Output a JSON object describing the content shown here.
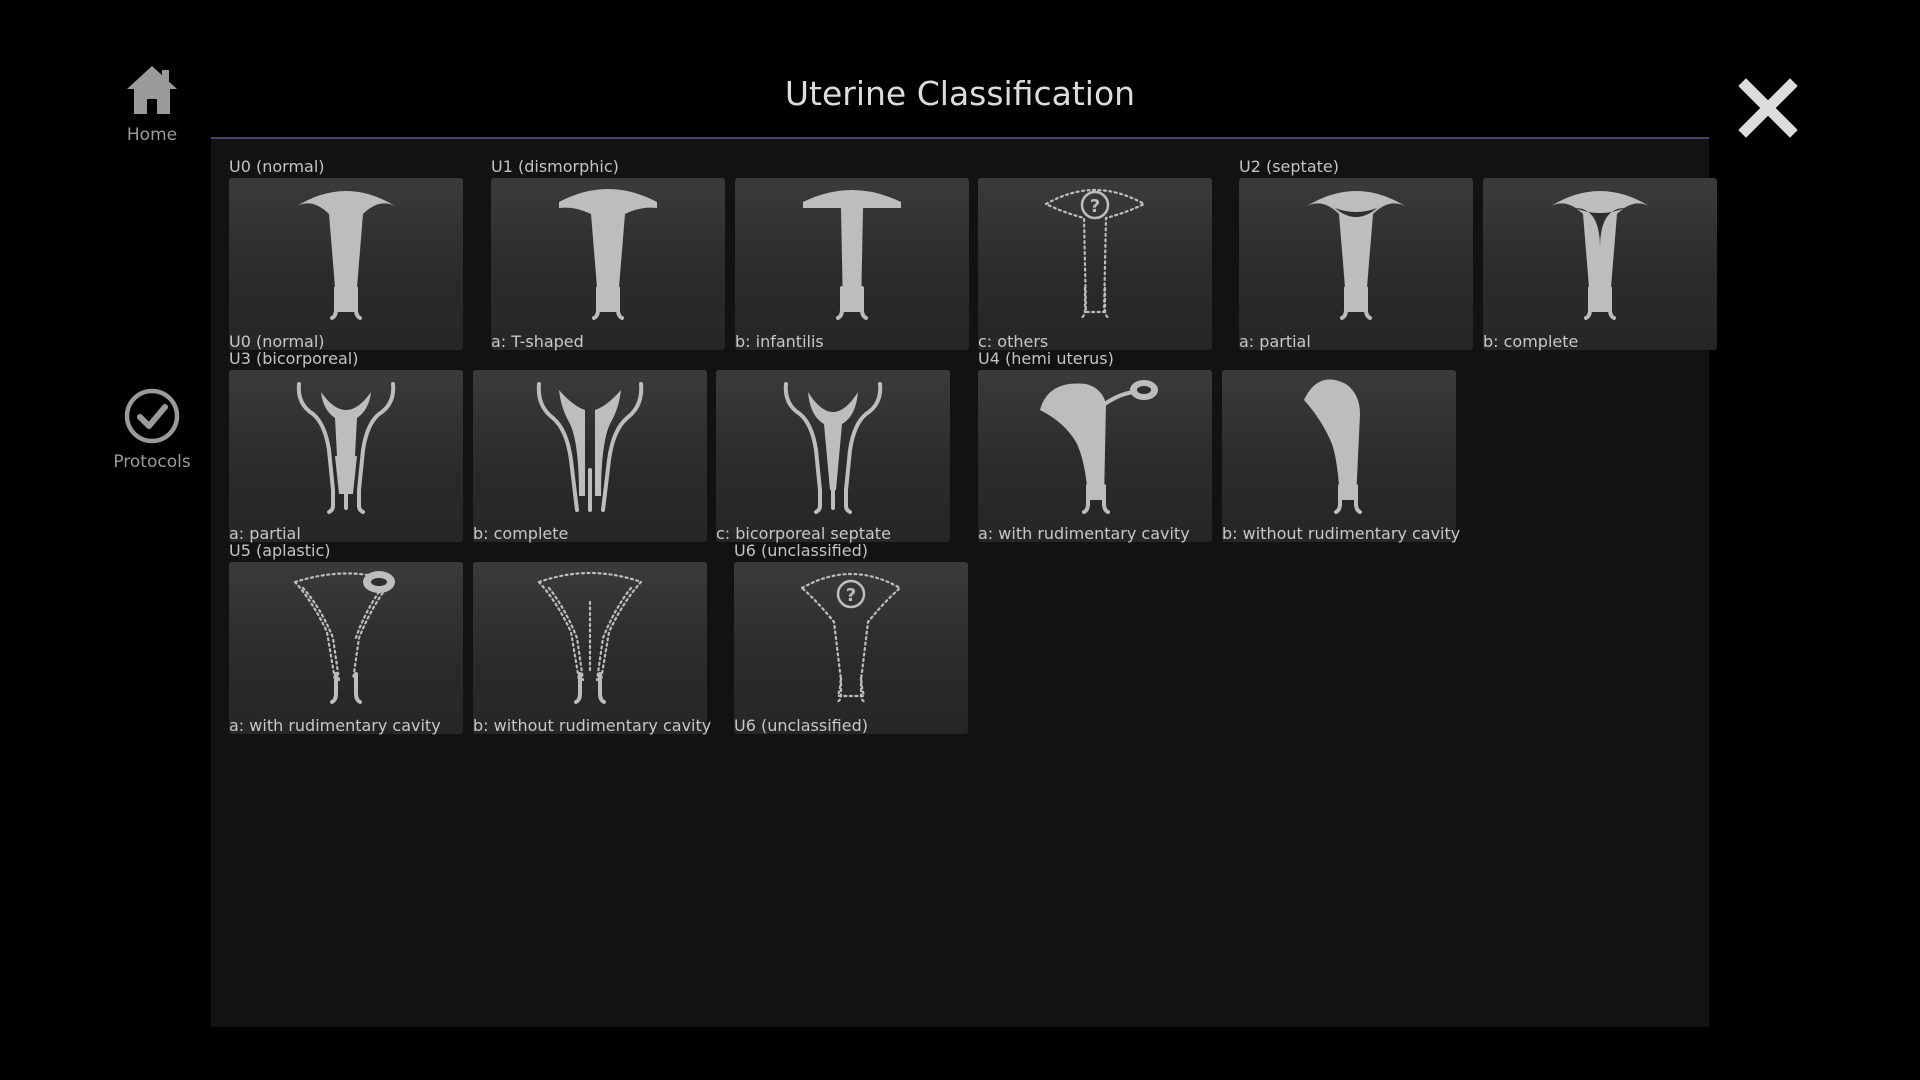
{
  "nav": {
    "home_label": "Home",
    "protocols_label": "Protocols"
  },
  "header": {
    "title": "Uterine Classification"
  },
  "groups": {
    "u0": "U0 (normal)",
    "u1": "U1 (dismorphic)",
    "u2": "U2 (septate)",
    "u3": "U3 (bicorporeal)",
    "u4": "U4 (hemi uterus)",
    "u5": "U5 (aplastic)",
    "u6": "U6 (unclassified)"
  },
  "tiles": {
    "u0_normal": "U0 (normal)",
    "u1a": "a: T-shaped",
    "u1b": "b: infantilis",
    "u1c": "c: others",
    "u2a": "a: partial",
    "u2b": "b: complete",
    "u3a": "a: partial",
    "u3b": "b: complete",
    "u3c": "c: bicorporeal septate",
    "u4a": "a: with rudimentary cavity",
    "u4b": "b: without rudimentary cavity",
    "u5a": "a: with rudimentary cavity",
    "u5b": "b: without rudimentary cavity",
    "u6": "U6 (unclassified)"
  },
  "icons": {
    "home": "home-icon",
    "protocols": "checkmark-circle-icon",
    "close": "close-icon",
    "unknown": "question-mark-icon"
  },
  "colors": {
    "background": "#000000",
    "panel": "#121212",
    "tile": "#2e2e2e",
    "accent_line": "#45456b",
    "shape": "#bdbdbd"
  }
}
